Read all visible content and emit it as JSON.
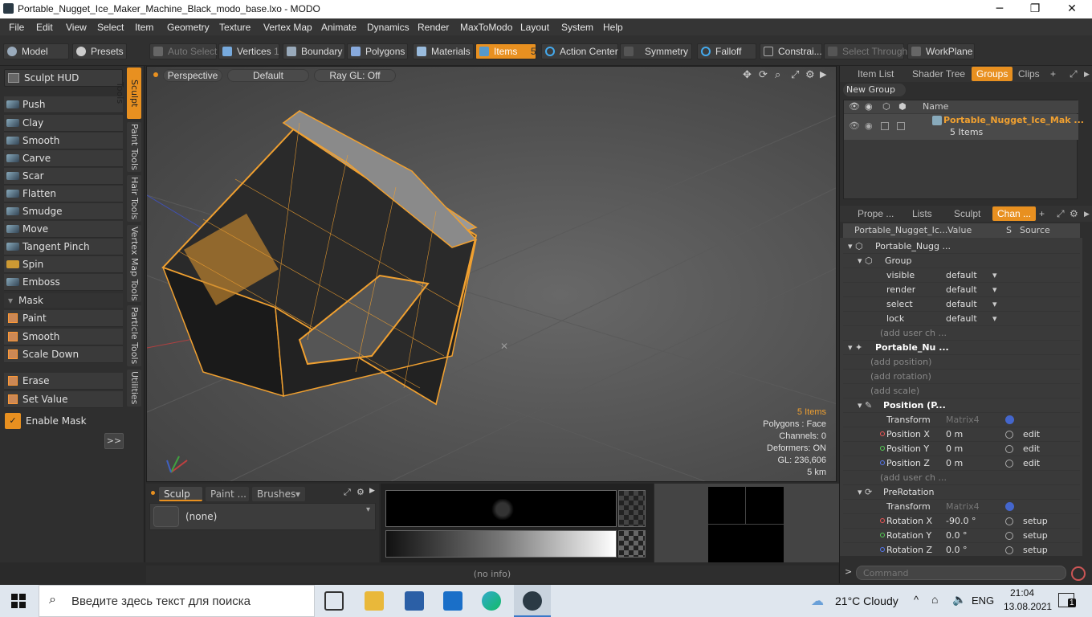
{
  "window": {
    "title": "Portable_Nugget_Ice_Maker_Machine_Black_modo_base.lxo - MODO",
    "minimize": "─",
    "maximize": "❐",
    "close": "✕"
  },
  "menu": [
    "File",
    "Edit",
    "View",
    "Select",
    "Item",
    "Geometry",
    "Texture",
    "Vertex Map",
    "Animate",
    "Dynamics",
    "Render",
    "MaxToModo",
    "Layout",
    "System",
    "Help"
  ],
  "toolbar": {
    "model": "Model",
    "presets": "Presets",
    "auto_select": "Auto Select",
    "vertices": "Vertices",
    "vertices_count": "1",
    "boundary": "Boundary",
    "polygons": "Polygons",
    "materials": "Materials",
    "items": "Items",
    "items_count": "5",
    "action_center": "Action Center",
    "symmetry": "Symmetry",
    "falloff": "Falloff",
    "constraints": "Constrai...",
    "select_through": "Select Through",
    "workplane": "WorkPlane"
  },
  "sculpt": {
    "hud": "Sculpt HUD",
    "tools": [
      "Push",
      "Clay",
      "Smooth",
      "Carve",
      "Scar",
      "Flatten",
      "Smudge",
      "Move",
      "Tangent Pinch",
      "Spin",
      "Emboss"
    ],
    "mask_header": "Mask",
    "mask_tools": [
      "Paint",
      "Smooth",
      "Scale Down"
    ],
    "extra_tools": [
      "Erase",
      "Set Value"
    ],
    "enable_mask": "Enable Mask",
    "expand": ">>",
    "vtabs": [
      "Sculpt Tools",
      "Paint Tools",
      "Hair Tools",
      "Vertex Map Tools",
      "Particle Tools",
      "Utilities"
    ]
  },
  "viewport": {
    "perspective": "Perspective",
    "shading": "Default",
    "raygl": "Ray GL: Off",
    "stats": {
      "items": "5 Items",
      "polygons": "Polygons : Face",
      "channels": "Channels: 0",
      "deformers": "Deformers: ON",
      "gl": "GL: 236,606",
      "scale": "5 km"
    }
  },
  "bottom": {
    "tabs": [
      "Sculp ...",
      "Paint ...",
      "Brushes"
    ],
    "brush": "(none)"
  },
  "status": "(no info)",
  "right": {
    "top_tabs": [
      "Item List",
      "Shader Tree",
      "Groups",
      "Clips"
    ],
    "new_group": "New Group",
    "name_header": "Name",
    "group_name": "Portable_Nugget_Ice_Mak ...",
    "group_items": "5 Items",
    "bottom_tabs": [
      "Prope ...",
      "Lists",
      "Sculpt",
      "Chan ..."
    ],
    "channel_header": {
      "name": "Portable_Nugget_Ic...",
      "value": "Value",
      "s": "S",
      "source": "Source"
    },
    "channels": [
      {
        "name": "Portable_Nugg ...",
        "value": "",
        "src": ""
      },
      {
        "name": "Group",
        "value": "",
        "src": ""
      },
      {
        "name": "visible",
        "value": "default",
        "src": ""
      },
      {
        "name": "render",
        "value": "default",
        "src": ""
      },
      {
        "name": "select",
        "value": "default",
        "src": ""
      },
      {
        "name": "lock",
        "value": "default",
        "src": ""
      },
      {
        "name": "(add user ch ...",
        "value": "",
        "src": ""
      },
      {
        "name": "Portable_Nu ...",
        "value": "",
        "src": ""
      },
      {
        "name": "(add position)",
        "value": "",
        "src": ""
      },
      {
        "name": "(add rotation)",
        "value": "",
        "src": ""
      },
      {
        "name": "(add scale)",
        "value": "",
        "src": ""
      },
      {
        "name": "Position (P...",
        "value": "",
        "src": ""
      },
      {
        "name": "Transform",
        "value": "Matrix4",
        "src": ""
      },
      {
        "name": "Position X",
        "value": "0 m",
        "src": "edit"
      },
      {
        "name": "Position Y",
        "value": "0 m",
        "src": "edit"
      },
      {
        "name": "Position Z",
        "value": "0 m",
        "src": "edit"
      },
      {
        "name": "(add user ch ...",
        "value": "",
        "src": ""
      },
      {
        "name": "PreRotation",
        "value": "",
        "src": ""
      },
      {
        "name": "Transform",
        "value": "Matrix4",
        "src": ""
      },
      {
        "name": "Rotation X",
        "value": "-90.0 °",
        "src": "setup"
      },
      {
        "name": "Rotation Y",
        "value": "0.0 °",
        "src": "setup"
      },
      {
        "name": "Rotation Z",
        "value": "0.0 °",
        "src": "setup"
      }
    ],
    "command_placeholder": "Command"
  },
  "taskbar": {
    "search": "Введите здесь текст для поиска",
    "weather": "21°C  Cloudy",
    "lang": "ENG",
    "time": "21:04",
    "date": "13.08.2021",
    "notifications": "1"
  },
  "colors": {
    "accent": "#e89020",
    "wire": "#f0a030"
  }
}
